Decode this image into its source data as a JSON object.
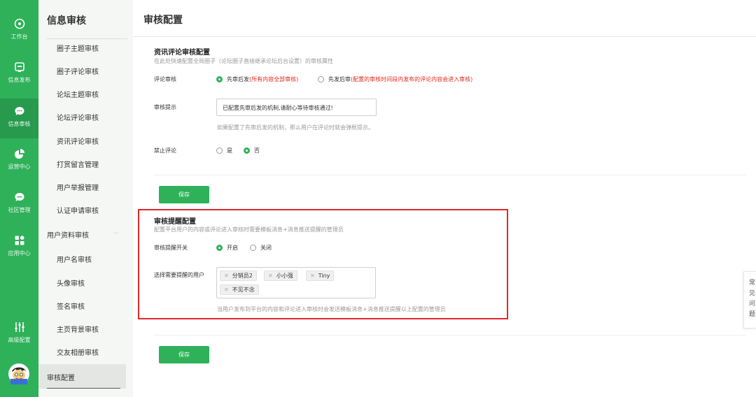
{
  "rail": {
    "items": [
      {
        "label": "工作台",
        "icon": "compass-icon"
      },
      {
        "label": "信息发布",
        "icon": "publish-icon"
      },
      {
        "label": "信息审核",
        "icon": "chat-bubble-icon"
      },
      {
        "label": "运营中心",
        "icon": "pie-chart-icon"
      },
      {
        "label": "社区管理",
        "icon": "community-icon"
      },
      {
        "label": "应用中心",
        "icon": "apps-grid-icon"
      },
      {
        "label": "高级配置",
        "icon": "sliders-icon"
      }
    ],
    "avatar": "avatar"
  },
  "menu": {
    "title": "信息审核",
    "items": [
      "圈子主题审核",
      "圈子评论审核",
      "论坛主题审核",
      "论坛评论审核",
      "资讯评论审核",
      "打赏留言管理",
      "用户举报管理",
      "认证申请审核"
    ],
    "group_label": "用户资料审核",
    "group_items": [
      "用户名审核",
      "头像审核",
      "签名审核",
      "主页背景审核",
      "交友相册审核"
    ],
    "active": "审核配置"
  },
  "page": {
    "title": "审核配置"
  },
  "comment_section": {
    "title": "资讯评论审核配置",
    "desc": "在此处快速配置全局圈子（论坛圈子直接继承论坛后台设置）的审核属性",
    "review_label": "评论审核",
    "option1_label": "先审后发",
    "option1_note": "(所有内容全部审核)",
    "option2_label": "先发后审",
    "option2_note": "(配置的审核时间段内发布的评论内容会进入审核)",
    "tip_label": "审核提示",
    "tip_value": "已配置先审后发的机制,请耐心等待审核通过!",
    "tip_hint": "如果配置了先审后发的机制，那么用户在评论时就会弹框提示。",
    "forbid_label": "禁止评论",
    "forbid_yes": "是",
    "forbid_no": "否",
    "save_label": "保存"
  },
  "reminder_section": {
    "title": "审核提醒配置",
    "desc": "配置平台用户的内容或评论进入审核时需要模板消息+消息推送提醒的管理员",
    "switch_label": "审核提醒开关",
    "switch_on": "开启",
    "switch_off": "关闭",
    "users_label": "选择需要提醒的用户",
    "users": [
      "分销员2",
      "小小强",
      "Tiny",
      "不见不念"
    ],
    "users_hint": "当用户发布到平台的内容和评论进入审核时会发送模板消息+消息推送提醒以上配置的管理员",
    "save_label": "保存"
  },
  "float_help": {
    "label": "常见问题"
  },
  "colors": {
    "brand": "#2fb15a",
    "alert": "#e5261b",
    "highlight": "#e0262b"
  }
}
